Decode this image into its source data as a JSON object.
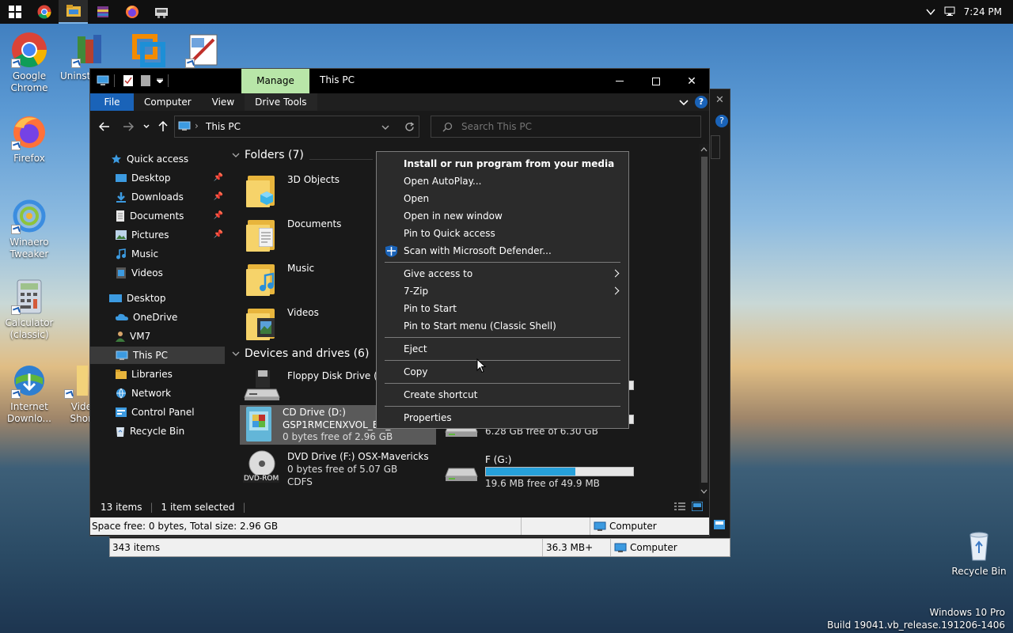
{
  "taskbar": {
    "apps": [
      "start-icon",
      "chrome-icon",
      "file-explorer-icon",
      "winrar-icon",
      "firefox-icon",
      "control-panel-icon"
    ],
    "time": "7:24 PM"
  },
  "desktop": {
    "icons": [
      {
        "label": "Google Chrome"
      },
      {
        "label": "Uninst"
      },
      {
        "label": "Firefox"
      },
      {
        "label": "Winaero Tweaker"
      },
      {
        "label": "Calculator (classic)"
      },
      {
        "label": "Internet Downlo..."
      },
      {
        "label": "Vide Shor"
      },
      {
        "label": "Recycle Bin"
      }
    ],
    "watermark_line1": "Windows 10 Pro",
    "watermark_line2": "Build 19041.vb_release.191206-1406"
  },
  "back_window": {
    "items_count": "343 items",
    "size": "36.3 MB+",
    "location": "Computer"
  },
  "explorer": {
    "title": "This PC",
    "manage_tab": "Manage",
    "ribbon_tabs": [
      "File",
      "Computer",
      "View",
      "Drive Tools"
    ],
    "address": "This PC",
    "search_placeholder": "Search This PC",
    "nav": {
      "quick_access": "Quick access",
      "items": [
        "Desktop",
        "Downloads",
        "Documents",
        "Pictures",
        "Music",
        "Videos",
        "Desktop",
        "OneDrive",
        "VM7",
        "This PC",
        "Libraries",
        "Network",
        "Control Panel",
        "Recycle Bin"
      ]
    },
    "folders_header": "Folders (7)",
    "folders": [
      "3D Objects",
      "Documents",
      "Music",
      "Videos"
    ],
    "devices_header": "Devices and drives (6)",
    "drives": {
      "floppy": "Floppy Disk Drive (A:)",
      "cd_name": "CD Drive (D:)",
      "cd_label": "GSP1RMCENXVOL_EN_DVD",
      "cd_free": "0 bytes free of 2.96 GB",
      "dvd_name": "DVD Drive (F:) OSX-Mavericks",
      "dvd_free": "0 bytes free of 5.07 GB",
      "dvd_fs": "CDFS",
      "dvd_badge": "DVD-ROM",
      "e_free": "6.28 GB free of 6.30 GB",
      "g_name": "F (G:)",
      "g_free": "19.6 MB free of 49.9 MB",
      "g_used_fraction": 0.61
    },
    "status_items": "13 items",
    "status_selected": "1 item selected",
    "detail_space": "Space free: 0 bytes, Total size: 2.96 GB",
    "detail_location": "Computer"
  },
  "context_menu": {
    "items": [
      "Install or run program from your media",
      "Open AutoPlay...",
      "Open",
      "Open in new window",
      "Pin to Quick access",
      "Scan with Microsoft Defender...",
      "Give access to",
      "7-Zip",
      "Pin to Start",
      "Pin to Start menu (Classic Shell)",
      "Eject",
      "Copy",
      "Create shortcut",
      "Properties"
    ]
  }
}
